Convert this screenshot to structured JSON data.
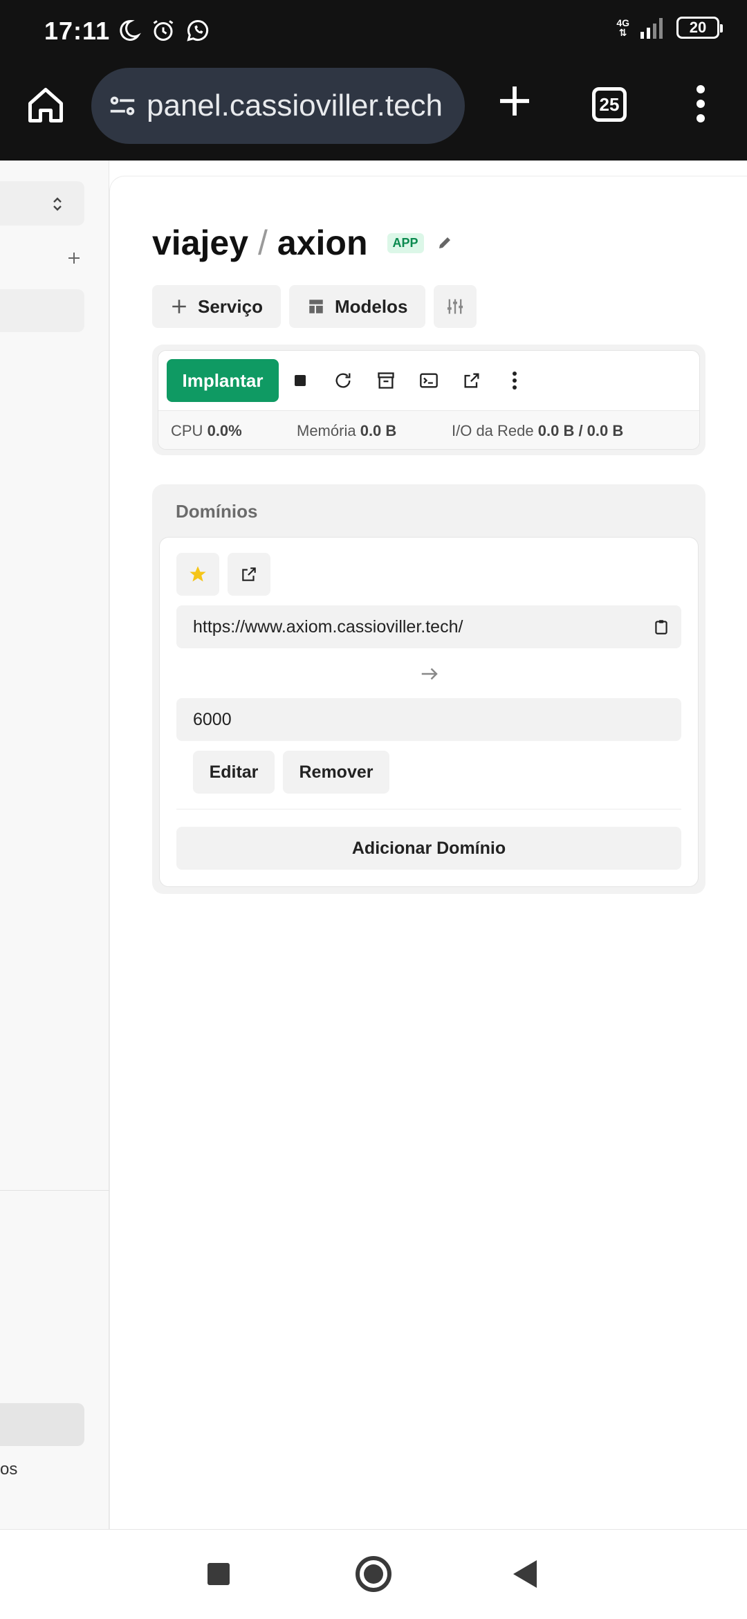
{
  "status_bar": {
    "time": "17:11",
    "network_label": "4G",
    "battery_level": "20",
    "icons": [
      "moon-icon",
      "alarm-icon",
      "whatsapp-icon",
      "signal-icon",
      "battery-icon"
    ]
  },
  "browser": {
    "url": "panel.cassioviller.tech",
    "tab_count": "25",
    "icons": [
      "home-icon",
      "site-settings-icon",
      "new-tab-icon",
      "tab-switcher-icon",
      "more-vert-icon"
    ]
  },
  "sidebar": {
    "bottom_label_fragment": "os"
  },
  "header": {
    "project": "viajey",
    "separator": "/",
    "app_name": "axion",
    "badge": "APP"
  },
  "toolbar": {
    "service_label": "Serviço",
    "templates_label": "Modelos"
  },
  "deploy": {
    "deploy_label": "Implantar",
    "stats": {
      "cpu_label": "CPU",
      "cpu_value": "0.0%",
      "memory_label": "Memória",
      "memory_value": "0.0 B",
      "network_label": "I/O da Rede",
      "network_value": "0.0 B / 0.0 B"
    }
  },
  "domains": {
    "title": "Domínios",
    "url": "https://www.axiom.cassioviller.tech/",
    "port": "6000",
    "edit_label": "Editar",
    "remove_label": "Remover",
    "add_label": "Adicionar Domínio"
  },
  "colors": {
    "accent_green": "#0f9a63",
    "badge_bg": "#dcf7e8",
    "badge_text": "#0b8a4f",
    "star": "#f5c518"
  }
}
